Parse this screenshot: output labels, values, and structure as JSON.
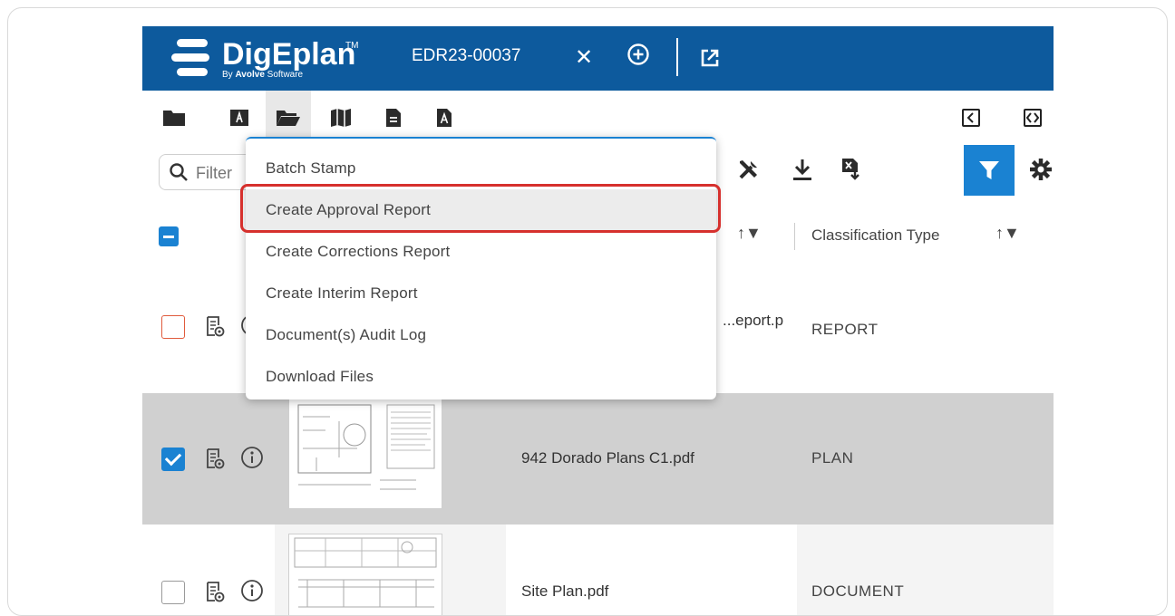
{
  "header": {
    "logo_title": "DigEplan",
    "logo_tm": "TM",
    "logo_sub_prefix": "By ",
    "logo_sub_brand": "Avolve",
    "logo_sub_suffix": " Software",
    "record_id": "EDR23-00037",
    "close_glyph": "✕"
  },
  "toolbar": {
    "search_placeholder": "Filter"
  },
  "table": {
    "columns": [
      {
        "label": "Classification Type",
        "sort_glyph": "↑▼"
      }
    ],
    "partial_sort_glyph": "↑▼",
    "rows": [
      {
        "filename": "...eport.p",
        "type": "REPORT",
        "checked": false
      },
      {
        "filename": "942 Dorado Plans C1.pdf",
        "type": "PLAN",
        "checked": true
      },
      {
        "filename": "Site Plan.pdf",
        "type": "DOCUMENT",
        "checked": false
      }
    ]
  },
  "menu": {
    "items": [
      "Batch Stamp",
      "Create Approval Report",
      "Create Corrections Report",
      "Create Interim Report",
      "Document(s) Audit Log",
      "Download Files"
    ],
    "highlighted_index": 1
  },
  "colors": {
    "header_bg": "#0d5a9d",
    "accent": "#1a82d2",
    "highlight_border": "#d6302d",
    "selected_row_bg": "#d0d0d0"
  }
}
